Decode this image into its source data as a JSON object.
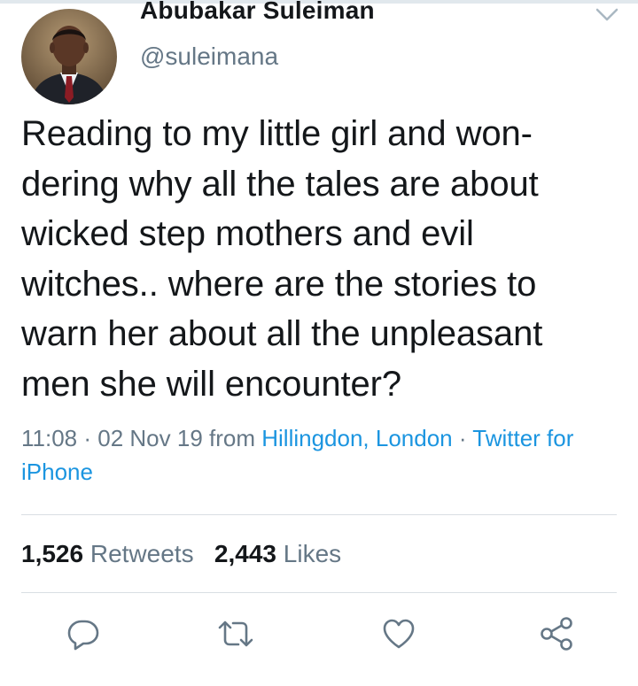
{
  "author": {
    "name": "Abubakar Suleiman",
    "handle": "@suleimana"
  },
  "tweet": {
    "text": "Reading to my little girl and won-\ndering why all the tales are about\nwicked step mothers and evil\nwitches..  where are the stories to\nwarn her about all the unpleasant\nmen she will encounter?"
  },
  "meta": {
    "time": "11:08",
    "separator": " · ",
    "date": "02 Nov 19",
    "from_label": " from ",
    "location": "Hillingdon, London",
    "source": "Twitter for iPhone"
  },
  "stats": {
    "retweets_count": "1,526",
    "retweets_label": "Retweets",
    "likes_count": "2,443",
    "likes_label": "Likes"
  },
  "icons": {
    "reply": "reply-icon",
    "retweet": "retweet-icon",
    "like": "heart-icon",
    "share": "share-icon",
    "more": "chevron-down-icon"
  },
  "colors": {
    "text_primary": "#14171a",
    "text_secondary": "#657786",
    "link": "#1b95e0",
    "divider": "#d9dee3"
  }
}
